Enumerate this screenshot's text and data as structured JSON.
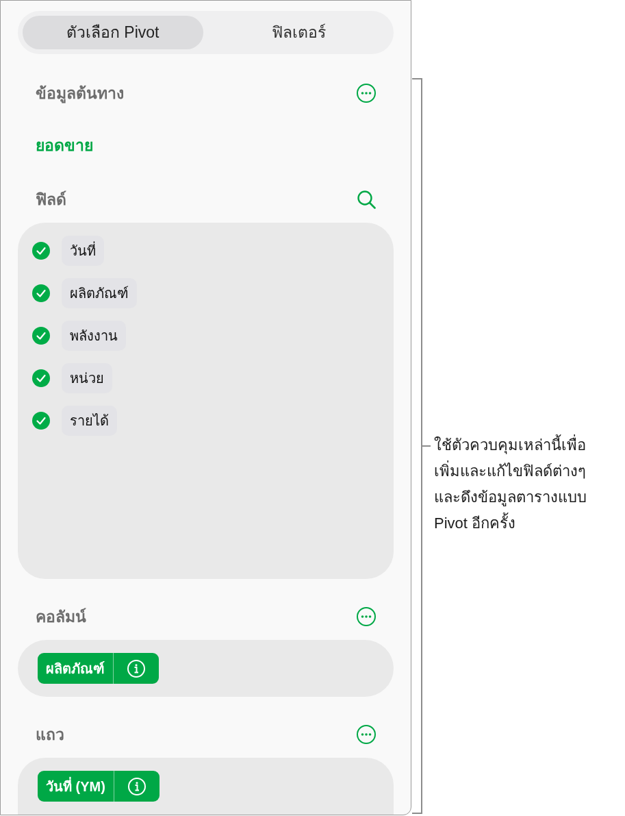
{
  "tabs": [
    {
      "label": "ตัวเลือก Pivot",
      "selected": true
    },
    {
      "label": "ฟิลเตอร์",
      "selected": false
    }
  ],
  "source_data": {
    "heading": "ข้อมูลต้นทาง",
    "value": "ยอดขาย"
  },
  "fields": {
    "heading": "ฟิลด์",
    "items": [
      {
        "label": "วันที่",
        "checked": true
      },
      {
        "label": "ผลิตภัณฑ์",
        "checked": true
      },
      {
        "label": "พลังงาน",
        "checked": true
      },
      {
        "label": "หน่วย",
        "checked": true
      },
      {
        "label": "รายได้",
        "checked": true
      }
    ]
  },
  "columns": {
    "heading": "คอลัมน์",
    "items": [
      {
        "label": "ผลิตภัณฑ์"
      }
    ]
  },
  "rows": {
    "heading": "แถว",
    "items": [
      {
        "label": "วันที่ (YM)"
      }
    ]
  },
  "callout": {
    "lines": [
      "ใช้ตัวควบคุมเหล่านี้เพื่อ",
      "เพิ่มและแก้ไขฟิลด์ต่างๆ",
      "และดึงข้อมูลตารางแบบ",
      "Pivot อีกครั้ง"
    ]
  }
}
